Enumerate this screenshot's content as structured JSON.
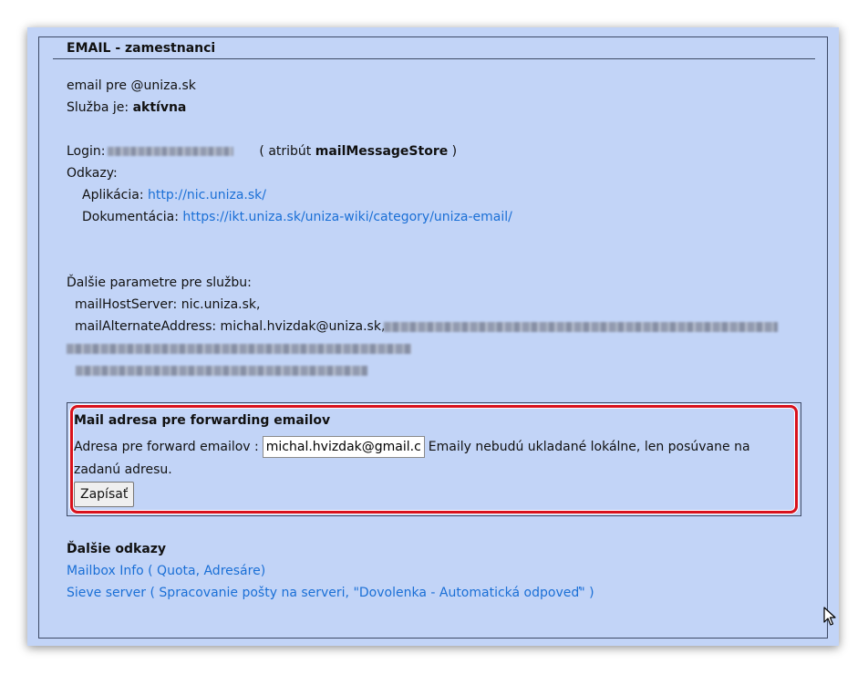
{
  "panel": {
    "title": "EMAIL - zamestnanci"
  },
  "service": {
    "email_line": "email pre @uniza.sk",
    "status_prefix": "Služba je: ",
    "status_value": "aktívna",
    "login_label": "Login:",
    "login_note_prefix": "( atribút ",
    "login_note_attr": "mailMessageStore",
    "login_note_suffix": " )",
    "links_label": "Odkazy:",
    "app_label": "Aplikácia: ",
    "app_url": "http://nic.uniza.sk/",
    "doc_label": "Dokumentácia: ",
    "doc_url": "https://ikt.uniza.sk/uniza-wiki/category/uniza-email/"
  },
  "params": {
    "heading": "Ďalšie parametre pre službu:",
    "host_server": "mailHostServer: nic.uniza.sk,",
    "alternate_prefix": "mailAlternateAddress: michal.hvizdak@uniza.sk,"
  },
  "forwarding": {
    "title": "Mail adresa pre forwarding emailov",
    "label": "Adresa pre forward emailov : ",
    "input_value": "michal.hvizdak@gmail.com",
    "note_part1": " Emaily nebudú ukladané lokálne, len posúvane na",
    "note_part2": "zadanú adresu.",
    "save_label": "Zapísať"
  },
  "more_links": {
    "heading": "Ďalšie odkazy",
    "mailbox_info": "Mailbox Info ( Quota, Adresáre)",
    "sieve_server": "Sieve server ( Spracovanie pošty na serveri, \"Dovolenka - Automatická odpoveď\" )"
  },
  "icons": {
    "cursor": "mouse-pointer-icon"
  }
}
